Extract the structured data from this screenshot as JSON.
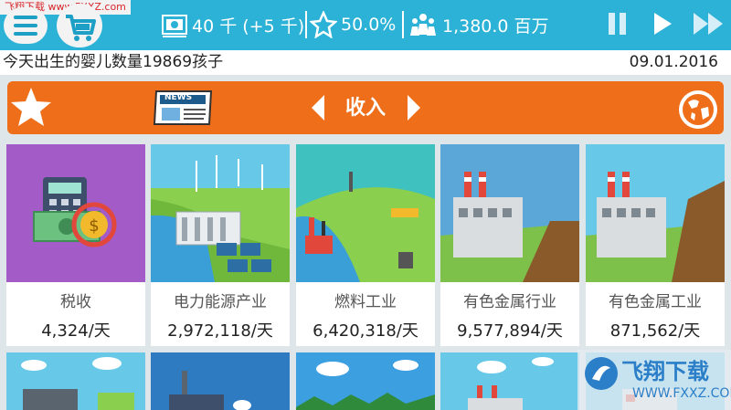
{
  "watermark_top": "飞翔下载 www.FXXZ.com",
  "topbar": {
    "money": "40 千 (+5 千)",
    "approval": "50.0%",
    "population": "1,380.0 百万",
    "icons": [
      "menu-icon",
      "cart-icon",
      "cash-icon",
      "star-icon",
      "people-icon",
      "pause-icon",
      "play-icon",
      "fast-forward-icon"
    ]
  },
  "ticker": {
    "text": "今天出生的婴儿数量19869孩子",
    "date": "09.01.2016"
  },
  "header": {
    "title": "收入",
    "news_label": "NEWS"
  },
  "cards": [
    {
      "name": "税收",
      "value": "4,324/天"
    },
    {
      "name": "电力能源产业",
      "value": "2,972,118/天"
    },
    {
      "name": "燃料工业",
      "value": "6,420,318/天"
    },
    {
      "name": "有色金属行业",
      "value": "9,577,894/天"
    },
    {
      "name": "有色金属工业",
      "value": "871,562/天"
    }
  ],
  "watermark_bottom": {
    "brand": "飞翔下载",
    "url": "WWW.FXXZ.COM"
  },
  "colors": {
    "topbar": "#2bb2d6",
    "header": "#ee6e1a",
    "background": "#dfe6ea"
  }
}
